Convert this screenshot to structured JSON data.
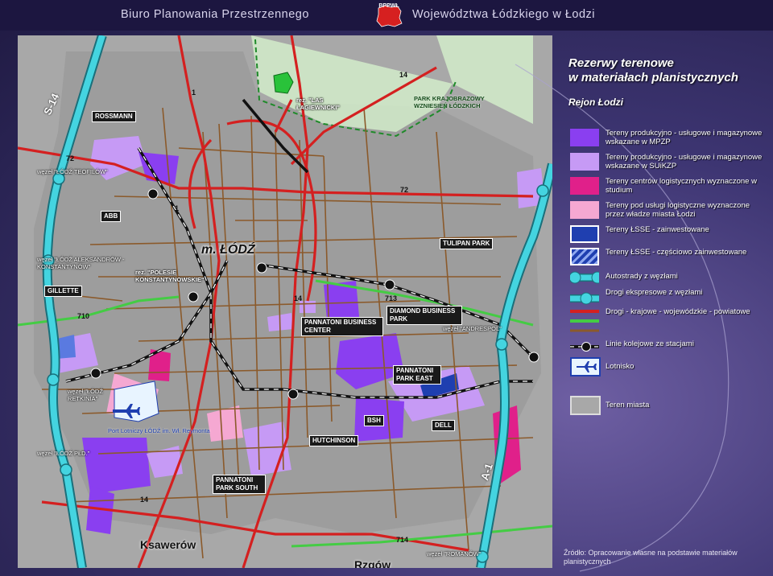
{
  "header": {
    "left_title": "Biuro Planowania Przestrzennego",
    "right_title": "Województwa Łódzkiego w Łodzi",
    "logo_text": "BPPWŁ"
  },
  "map": {
    "city_name": "m. ŁÓDŹ",
    "towns": [
      "Ksawerów",
      "Rzgów"
    ],
    "road_numbers": [
      "S-14",
      "A-1",
      "72",
      "72",
      "14",
      "14",
      "1",
      "1",
      "713",
      "710",
      "714",
      "14"
    ],
    "nodes": [
      "węzeł \"ŁÓDŹ TEOFILÓW\"",
      "węzeł \"ŁÓDŹ ALEKSANDRÓW - KONSTANTYNÓW\"",
      "węzeł \"ŁÓDŹ RETKINIA\"",
      "węzeł \"ŁÓDŹ PŁD.\"",
      "węzeł \"ANDRESPOL\"",
      "węzeł \"ROMANÓW\""
    ],
    "reserves": [
      "rez. \"LAS ŁAGIEWNICKI\"",
      "rez. \"POLESIE KONSTANTYNOWSKIE\""
    ],
    "park": "PARK KRAJOBRAZOWY WZNIESIEŃ ŁÓDZKICH",
    "airport": "Port Lotniczy ŁÓDŹ im. Wł. Reymonta",
    "companies": [
      "ROSSMANN",
      "ABB",
      "GILLETTE",
      "TULIPAN PARK",
      "DIAMOND BUSINESS PARK",
      "PANNATONI BUSINESS CENTER",
      "PANNATONI PARK EAST",
      "BSH",
      "DELL",
      "HUTCHINSON",
      "PANNATONI PARK SOUTH"
    ]
  },
  "legend": {
    "title_line1": "Rezerwy terenowe",
    "title_line2": "w materiałach planistycznych",
    "subtitle": "Rejon Łodzi",
    "items": [
      {
        "label": "Tereny produkcyjno - usługowe i magazynowe wskazane w MPZP",
        "color": "#8a3ff0"
      },
      {
        "label": "Tereny produkcyjno - usługowe i magazynowe wskazane w SUiKZP",
        "color": "#c69af5"
      },
      {
        "label": "Tereny centrów logistycznych wyznaczone w studium",
        "color": "#e0208a"
      },
      {
        "label": "Tereny pod usługi logistyczne wyznaczone przez władze miasta Łodzi",
        "color": "#f5a8d2"
      },
      {
        "label": "Tereny ŁSSE - zainwestowane",
        "color": "#1f3fb0"
      },
      {
        "label": "Tereny ŁSSE - częściowo zainwestowane",
        "color": "#5a7ae0"
      },
      {
        "label": "Autostrady z węzłami",
        "color": "#44d4e0"
      },
      {
        "label": "Drogi ekspresowe z węzłami",
        "color": "#44d4e0"
      },
      {
        "label": "Drogi - krajowe - wojewódzkie - powiatowe",
        "color": "#d42020"
      },
      {
        "label": "Linie kolejowe ze stacjami",
        "color": "#111111"
      },
      {
        "label": "Lotnisko",
        "color": "#1f3fb0"
      },
      {
        "label": "Teren miasta",
        "color": "#a8a8a8"
      }
    ],
    "source": "Źródło: Opracowanie własne na podstawie materiałów planistycznych"
  }
}
